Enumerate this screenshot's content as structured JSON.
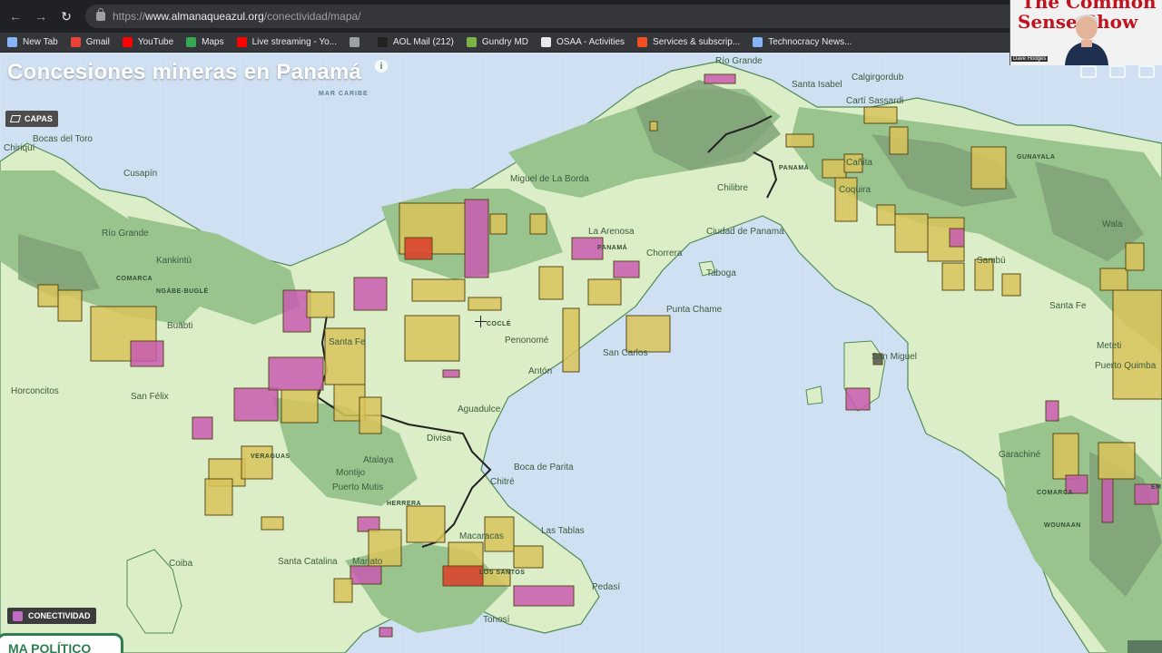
{
  "browser": {
    "url_prefix": "https://",
    "url_domain": "www.almanaqueazul.org",
    "url_path": "/conectividad/mapa/",
    "bookmarks": [
      {
        "label": "New Tab",
        "icon": "apps-grid-icon",
        "color": "#8ab4f8"
      },
      {
        "label": "Gmail",
        "icon": "gmail-icon",
        "color": "#ea4335"
      },
      {
        "label": "YouTube",
        "icon": "youtube-icon",
        "color": "#ff0000"
      },
      {
        "label": "Maps",
        "icon": "maps-icon",
        "color": "#34a853"
      },
      {
        "label": "Live streaming - Yo...",
        "icon": "youtube-icon",
        "color": "#ff0000"
      },
      {
        "label": "",
        "icon": "globe-icon",
        "color": "#9aa0a6"
      },
      {
        "label": "AOL Mail (212)",
        "icon": "aol-icon",
        "color": "#222222"
      },
      {
        "label": "Gundry MD",
        "icon": "leaf-icon",
        "color": "#7cb342"
      },
      {
        "label": "OSAA - Activities",
        "icon": "osaa-icon",
        "color": "#e8eaed"
      },
      {
        "label": "Services & subscrip...",
        "icon": "microsoft-icon",
        "color": "#f25022"
      },
      {
        "label": "Technocracy News...",
        "icon": "globe-icon",
        "color": "#8ab4f8"
      }
    ]
  },
  "map": {
    "title": "Concesiones mineras en Panamá",
    "layers_button": "CAPAS",
    "connectivity_button": "CONECTIVIDAD",
    "political_tab": "MA POLÍTICO",
    "sea_label": "MAR CARIBE",
    "colors": {
      "water": "#cfe0f2",
      "land": "#dbeec8",
      "forest": "#9ac48e",
      "dark_forest": "#7fa278",
      "concession_yellow": "#d8c35a",
      "concession_pink": "#c85ab0",
      "concession_red": "#d9452e",
      "border": "#222222"
    },
    "places": [
      "Bocas del Toro",
      "Chiriquí",
      "Cusapín",
      "Río Grande",
      "Kankintú",
      "COMARCA",
      "NGÄBE-BUGLÉ",
      "Buäbti",
      "Horconcitos",
      "San Félix",
      "Miguel de La Borda",
      "La Arenosa",
      "PANAMÁ",
      "Chorrera",
      "Ciudad de Panamá",
      "Taboga",
      "Punta Chame",
      "Penonomé",
      "COCLÉ",
      "Antón",
      "San Carlos",
      "Santa Fe",
      "VERAGUAS",
      "Aguadulce",
      "Divisa",
      "Boca de Parita",
      "Chitré",
      "Montijo",
      "Puerto Mutis",
      "HERRERA",
      "Atalaya",
      "Macaracas",
      "LOS SANTOS",
      "Las Tablas",
      "Pedasí",
      "Coiba",
      "Santa Catalina",
      "Mariato",
      "Tonosí",
      "Río Grande",
      "Santa Isabel",
      "Calgirgordub",
      "Cartí Sassardi",
      "Chilibre",
      "Cañita",
      "Coquira",
      "PANAMÁ",
      "Sambú",
      "Wala",
      "Santa Fe",
      "Meteti",
      "San Miguel",
      "Puerto Quimba",
      "Garachiné",
      "COMARCA",
      "WOUNAAN",
      "EMBERÁ",
      "GUNAYALA"
    ]
  },
  "webcam": {
    "line1": "The Common",
    "line2": "Sense Show",
    "name_tag": "Dave Hodges"
  }
}
